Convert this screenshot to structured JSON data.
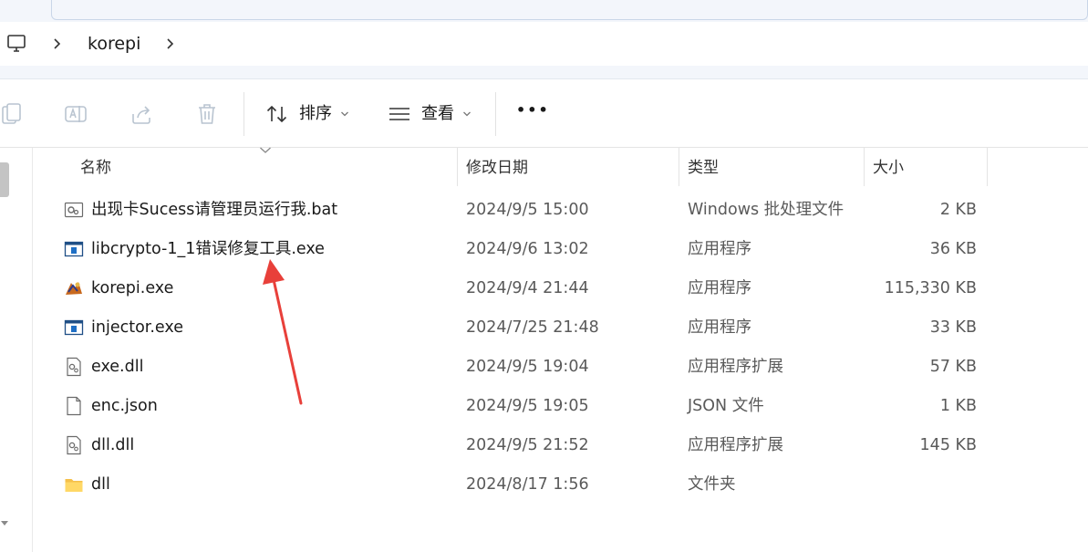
{
  "address": {
    "folder": "korepi"
  },
  "toolbar": {
    "sort_label": "排序",
    "view_label": "查看",
    "more_label": "•••"
  },
  "columns": {
    "name": "名称",
    "modified": "修改日期",
    "type": "类型",
    "size": "大小"
  },
  "files": [
    {
      "name": "出现卡Sucess请管理员运行我.bat",
      "modified": "2024/9/5 15:00",
      "type": "Windows 批处理文件",
      "size": "2 KB",
      "icon": "batch-file-icon"
    },
    {
      "name": "libcrypto-1_1错误修复工具.exe",
      "modified": "2024/9/6 13:02",
      "type": "应用程序",
      "size": "36 KB",
      "icon": "exe-file-icon"
    },
    {
      "name": "korepi.exe",
      "modified": "2024/9/4 21:44",
      "type": "应用程序",
      "size": "115,330 KB",
      "icon": "korepi-app-icon"
    },
    {
      "name": "injector.exe",
      "modified": "2024/7/25 21:48",
      "type": "应用程序",
      "size": "33 KB",
      "icon": "exe-file-icon"
    },
    {
      "name": "exe.dll",
      "modified": "2024/9/5 19:04",
      "type": "应用程序扩展",
      "size": "57 KB",
      "icon": "dll-file-icon"
    },
    {
      "name": "enc.json",
      "modified": "2024/9/5 19:05",
      "type": "JSON 文件",
      "size": "1 KB",
      "icon": "json-file-icon"
    },
    {
      "name": "dll.dll",
      "modified": "2024/9/5 21:52",
      "type": "应用程序扩展",
      "size": "145 KB",
      "icon": "dll-file-icon"
    },
    {
      "name": "dll",
      "modified": "2024/8/17 1:56",
      "type": "文件夹",
      "size": "",
      "icon": "folder-icon"
    }
  ],
  "colors": {
    "annotation_arrow": "#e8403a",
    "folder": "#f5c04a",
    "exe_blue": "#1f6fc5"
  }
}
